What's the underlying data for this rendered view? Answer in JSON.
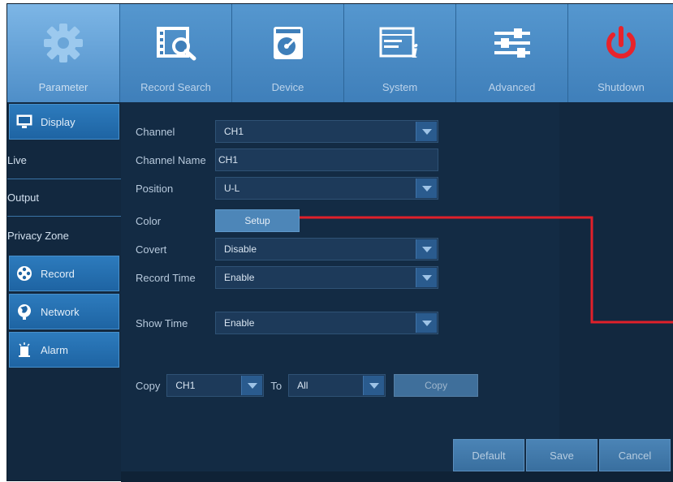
{
  "nav": {
    "tabs": [
      {
        "label": "Parameter",
        "icon": "gear-icon",
        "active": true
      },
      {
        "label": "Record Search",
        "icon": "film-search-icon"
      },
      {
        "label": "Device",
        "icon": "disk-icon"
      },
      {
        "label": "System",
        "icon": "system-info-icon"
      },
      {
        "label": "Advanced",
        "icon": "sliders-icon"
      },
      {
        "label": "Shutdown",
        "icon": "power-icon"
      }
    ]
  },
  "sidebar": {
    "display": "Display",
    "live": "Live",
    "output": "Output",
    "privacy_zone": "Privacy Zone",
    "record": "Record",
    "network": "Network",
    "alarm": "Alarm"
  },
  "form": {
    "channel": {
      "label": "Channel",
      "value": "CH1"
    },
    "channel_name": {
      "label": "Channel Name",
      "value": "CH1"
    },
    "position": {
      "label": "Position",
      "value": "U-L"
    },
    "color": {
      "label": "Color",
      "button": "Setup"
    },
    "covert": {
      "label": "Covert",
      "value": "Disable"
    },
    "record_time": {
      "label": "Record Time",
      "value": "Enable"
    },
    "show_time": {
      "label": "Show Time",
      "value": "Enable"
    }
  },
  "copy": {
    "label": "Copy",
    "from_value": "CH1",
    "to_label": "To",
    "to_value": "All",
    "button": "Copy"
  },
  "actions": {
    "default": "Default",
    "save": "Save",
    "cancel": "Cancel"
  },
  "colors": {
    "accent": "#4a8ac2",
    "background": "#12283f",
    "annotation": "#e0202a",
    "shutdown": "#e8232b"
  }
}
